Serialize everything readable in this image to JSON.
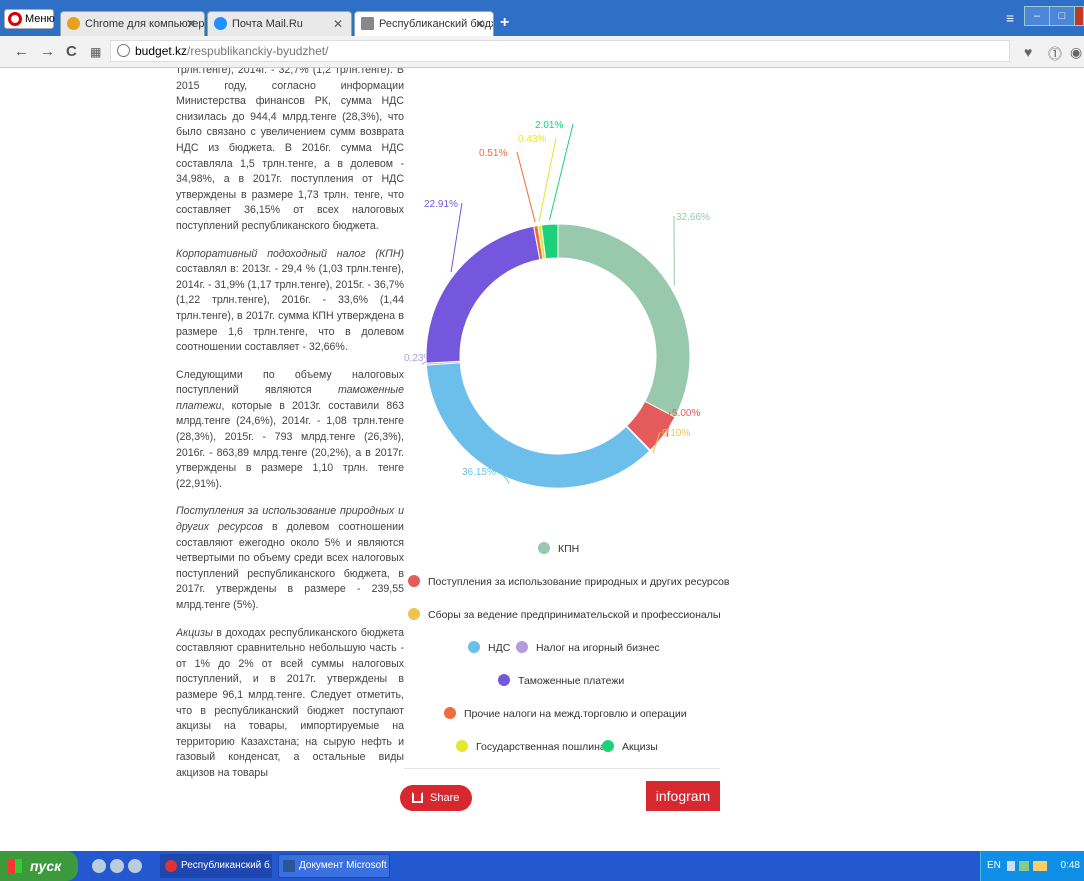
{
  "browser": {
    "menu_label": "Меню",
    "tabs": [
      {
        "label": "Chrome для компьютеров",
        "favicon_color": "#e8a020",
        "active": false
      },
      {
        "label": "Почта Mail.Ru",
        "favicon_color": "#1e90ff",
        "active": false
      },
      {
        "label": "Республиканский бюджет - ...",
        "favicon_color": "#888888",
        "active": true
      }
    ],
    "url_domain": "budget.kz",
    "url_path": "/respublikanckiy-byudzhet/"
  },
  "article": {
    "p1": "трлн.тенге), 2014г. - 32,7% (1,2 трлн.тенге). В 2015 году, согласно информации Министерства финансов РК, сумма НДС снизилась до 944,4 млрд.тенге (28,3%), что было связано с увеличением сумм возврата НДС из бюджета. В 2016г. сумма НДС составляла 1,5 трлн.тенге, а в долевом - 34,98%, а в 2017г. поступления от НДС утверждены в размере 1,73 трлн. тенге, что составляет 36,15% от всех налоговых поступлений республиканского бюджета.",
    "p2_em": "Корпоративный подоходный налог (КПН)",
    "p2": " составлял в: 2013г. - 29,4 % (1,03 трлн.тенге), 2014г. - 31,9% (1,17 трлн.тенге), 2015г. - 36,7% (1,22 трлн.тенге), 2016г. - 33,6% (1,44 трлн.тенге), в 2017г. сумма КПН утверждена в размере 1,6 трлн.тенге, что в долевом соотношении составляет - 32,66%.",
    "p3_a": "Следующими по объему налоговых поступлений являются ",
    "p3_em": "таможенные платежи",
    "p3_b": ", которые в 2013г. составили 863 млрд.тенге (24,6%), 2014г. - 1,08 трлн.тенге (28,3%), 2015г. - 793 млрд.тенге (26,3%), 2016г. - 863,89 млрд.тенге (20,2%), а в 2017г. утверждены в размере 1,10 трлн. тенге (22,91%).",
    "p4_em": "Поступления за использование природных и других ресурсов",
    "p4": " в долевом соотношении составляют ежегодно около 5% и являются четвертыми по объему среди всех налоговых поступлений республиканского бюджета, в 2017г. утверждены в размере - 239,55 млрд.тенге (5%).",
    "p5_em": "Акцизы",
    "p5": " в доходах республиканского бюджета составляют сравнительно небольшую часть - от 1% до 2% от всей суммы налоговых поступлений, и в 2017г. утверждены в размере 96,1 млрд.тенге. Следует отметить, что в республиканский бюджет поступают акцизы на товары, импортируемые на территорию Казахстана; на сырую нефть и газовый конденсат, а остальные виды акцизов на товары"
  },
  "chart_data": {
    "type": "pie",
    "style": "donut",
    "series": [
      {
        "name": "КПН",
        "value": 32.66,
        "label": "32.66%",
        "color": "#98c9ad"
      },
      {
        "name": "Поступления за использование природных и других ресурсов",
        "value": 5.0,
        "label": "5.00%",
        "color": "#e55a5a"
      },
      {
        "name": "Сборы за ведение предпринимательской и профессиональной...",
        "value": 0.1,
        "label": "0.10%",
        "color": "#f2c14e"
      },
      {
        "name": "НДС",
        "value": 36.15,
        "label": "36.15%",
        "color": "#6bbfea"
      },
      {
        "name": "Налог на игорный бизнес",
        "value": 0.23,
        "label": "0.23%",
        "color": "#b39ddb"
      },
      {
        "name": "Таможенные платежи",
        "value": 22.91,
        "label": "22.91%",
        "color": "#7457dc"
      },
      {
        "name": "Прочие налоги на межд.торговлю и операции",
        "value": 0.51,
        "label": "0.51%",
        "color": "#f26b3a"
      },
      {
        "name": "Государственная пошлина",
        "value": 0.43,
        "label": "0.43%",
        "color": "#e3e72d"
      },
      {
        "name": "Акцизы",
        "value": 2.01,
        "label": "2.01%",
        "color": "#1dd17a"
      }
    ],
    "legend_position": "bottom"
  },
  "widget": {
    "share_label": "Share",
    "brand_label": "infogram"
  },
  "taskbar": {
    "start_label": "пуск",
    "buttons": [
      "Республиканский б...",
      "Документ Microsoft ..."
    ],
    "lang": "EN",
    "clock": "0:48"
  }
}
